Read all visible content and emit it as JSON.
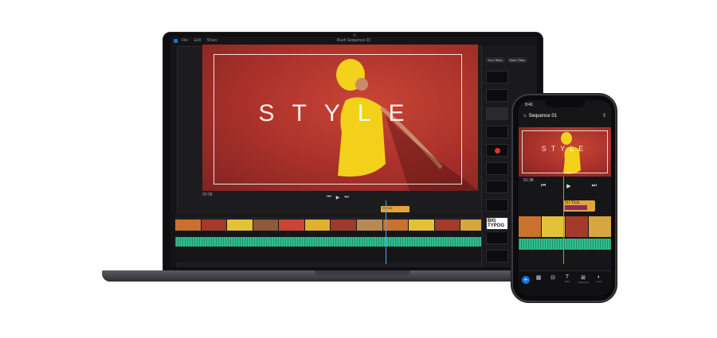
{
  "laptop": {
    "window_title": "Rush Sequence 01",
    "menu_tabs": [
      "File",
      "Edit",
      "Share"
    ],
    "preview_title_text": "STYLE",
    "timecode": "00:08",
    "title_clip_label": "STYLE",
    "panel_buttons": [
      "Your Titles",
      "More Titles"
    ],
    "big_typo_text": "BIG TYPOG"
  },
  "phone": {
    "status_time": "9:41",
    "sequence_title": "Sequence 01",
    "preview_title_text": "STYLE",
    "timecode": "01:38",
    "title_clip_label": "STYLE",
    "toolbar_labels": [
      "Titles",
      "Transitions",
      "Color"
    ]
  },
  "colors": {
    "accent": "#1473e6",
    "audio_track": "#2fbf8f",
    "title_clip": "#e0a63a",
    "playhead": "#4aa3ff"
  }
}
